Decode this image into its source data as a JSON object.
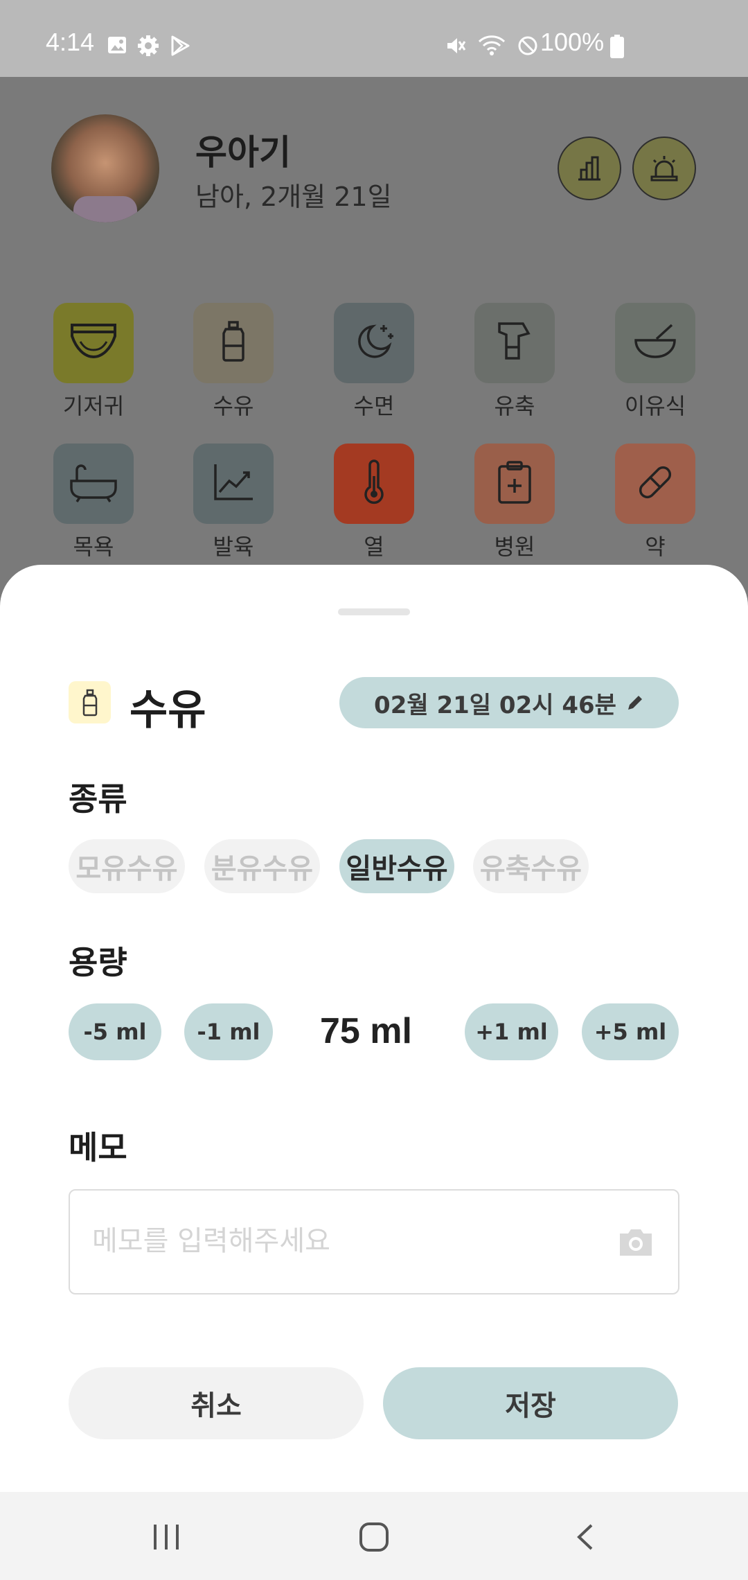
{
  "status_bar": {
    "time": "4:14",
    "battery": "100%"
  },
  "profile": {
    "name": "우아기",
    "info": "남아, 2개월 21일"
  },
  "header_buttons": [
    "stats-chart-icon",
    "alarm-siren-icon"
  ],
  "categories": [
    {
      "label": "기저귀",
      "icon": "diaper-icon",
      "color": "#7a7a2a"
    },
    {
      "label": "수유",
      "icon": "bottle-icon",
      "color": "#7c7666"
    },
    {
      "label": "수면",
      "icon": "moon-icon",
      "color": "#5f686a"
    },
    {
      "label": "유축",
      "icon": "breast-pump-icon",
      "color": "#6b6f6b"
    },
    {
      "label": "이유식",
      "icon": "bowl-icon",
      "color": "#6b716b"
    },
    {
      "label": "목욕",
      "icon": "bathtub-icon",
      "color": "#5f6a6c"
    },
    {
      "label": "발육",
      "icon": "growth-chart-icon",
      "color": "#5f6a6c"
    },
    {
      "label": "열",
      "icon": "thermometer-icon",
      "color": "#a43a22"
    },
    {
      "label": "병원",
      "icon": "clipboard-icon",
      "color": "#9a5f4a"
    },
    {
      "label": "약",
      "icon": "pill-icon",
      "color": "#9f5f4b"
    }
  ],
  "sheet": {
    "title": "수유",
    "datetime": "02월 21일 02시 46분",
    "type_label": "종류",
    "types": [
      "모유수유",
      "분유수유",
      "일반수유",
      "유축수유"
    ],
    "selected_type": "일반수유",
    "amount_label": "용량",
    "minus5": "-5 ml",
    "minus1": "-1 ml",
    "amount": "75  ml",
    "plus1": "+1 ml",
    "plus5": "+5 ml",
    "memo_label": "메모",
    "memo_placeholder": "메모를 입력해주세요",
    "cancel": "취소",
    "save": "저장"
  },
  "colors": {
    "accent": "#c3dadb",
    "chip_inactive": "#f2f2f2",
    "title_icon_bg": "#fff6cc"
  }
}
